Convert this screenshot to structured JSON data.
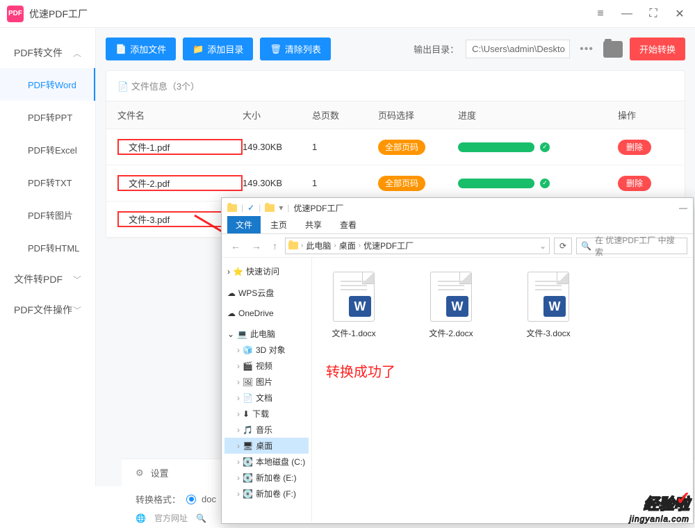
{
  "app": {
    "title": "优速PDF工厂"
  },
  "window_buttons": {
    "menu": "≡",
    "min": "—",
    "max": "⛶",
    "close": "✕"
  },
  "sidebar": {
    "cat1": {
      "label": "PDF转文件",
      "chev": "︿"
    },
    "items": [
      {
        "label": "PDF转Word"
      },
      {
        "label": "PDF转PPT"
      },
      {
        "label": "PDF转Excel"
      },
      {
        "label": "PDF转TXT"
      },
      {
        "label": "PDF转图片"
      },
      {
        "label": "PDF转HTML"
      }
    ],
    "cat2": {
      "label": "文件转PDF",
      "chev": "﹀"
    },
    "cat3": {
      "label": "PDF文件操作",
      "chev": "﹀"
    }
  },
  "toolbar": {
    "add_file": "添加文件",
    "add_dir": "添加目录",
    "clear": "清除列表",
    "out_label": "输出目录：",
    "out_path": "C:\\Users\\admin\\Deskto",
    "start": "开始转换"
  },
  "panel": {
    "head": "文件信息（3个）",
    "cols": {
      "name": "文件名",
      "size": "大小",
      "pages": "总页数",
      "sel": "页码选择",
      "prog": "进度",
      "op": "操作"
    },
    "rows": [
      {
        "name": "文件-1.pdf",
        "size": "149.30KB",
        "pages": "1",
        "sel": "全部页码",
        "del": "删除"
      },
      {
        "name": "文件-2.pdf",
        "size": "149.30KB",
        "pages": "1",
        "sel": "全部页码",
        "del": "删除"
      },
      {
        "name": "文件-3.pdf",
        "size": "",
        "pages": "",
        "sel": "",
        "del": ""
      }
    ]
  },
  "bottom": {
    "settings": "设置",
    "format_label": "转换格式：",
    "format_val": "doc"
  },
  "footer": {
    "site": "官方网址"
  },
  "explorer": {
    "title": "优速PDF工厂",
    "tabs": {
      "file": "文件",
      "home": "主页",
      "share": "共享",
      "view": "查看"
    },
    "crumbs": [
      "此电脑",
      "桌面",
      "优速PDF工厂"
    ],
    "search_ph": "在 优速PDF工厂 中搜索",
    "tree": {
      "quick": "快速访问",
      "wps": "WPS云盘",
      "onedrive": "OneDrive",
      "pc": "此电脑",
      "obj3d": "3D 对象",
      "video": "视频",
      "pic": "图片",
      "doc": "文档",
      "dl": "下载",
      "music": "音乐",
      "desktop": "桌面",
      "diskc": "本地磁盘 (C:)",
      "diske": "新加卷 (E:)",
      "diskf": "新加卷 (F:)"
    },
    "files": [
      {
        "name": "文件-1.docx"
      },
      {
        "name": "文件-2.docx"
      },
      {
        "name": "文件-3.docx"
      }
    ],
    "success": "转换成功了"
  },
  "watermark": {
    "big": "经验啦",
    "small": "jingyanla.com"
  }
}
